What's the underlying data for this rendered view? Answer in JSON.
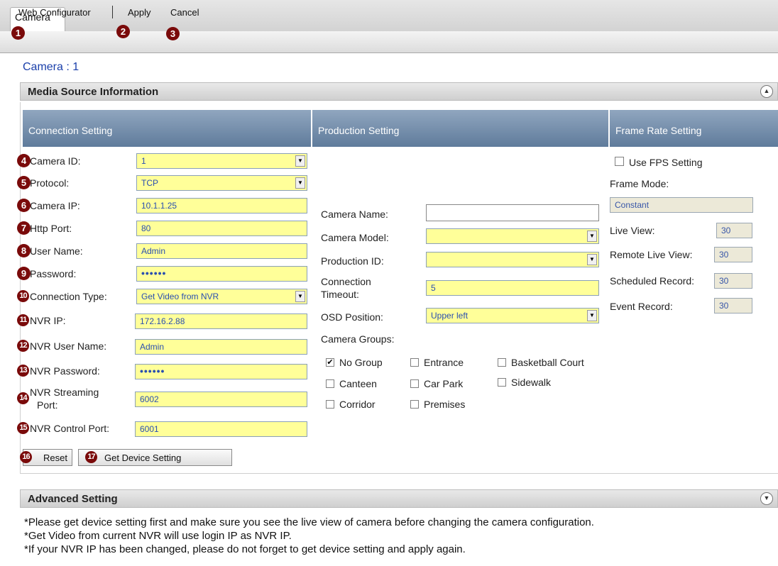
{
  "tab": {
    "label": "Camera"
  },
  "toolbar": {
    "web_configurator": "Web Configurator",
    "apply": "Apply",
    "cancel": "Cancel"
  },
  "page_title": "Camera : 1",
  "media_section": {
    "title": "Media Source Information"
  },
  "columns": {
    "connection": "Connection Setting",
    "production": "Production Setting",
    "framerate": "Frame Rate Setting"
  },
  "connection": {
    "camera_id": {
      "label": "Camera ID:",
      "value": "1"
    },
    "protocol": {
      "label": "Protocol:",
      "value": "TCP"
    },
    "camera_ip": {
      "label": "Camera IP:",
      "value": "10.1.1.25"
    },
    "http_port": {
      "label": "Http Port:",
      "value": "80"
    },
    "user_name": {
      "label": "User Name:",
      "value": "Admin"
    },
    "password": {
      "label": "Password:",
      "value": "••••••"
    },
    "connection_type": {
      "label": "Connection Type:",
      "value": "Get Video from NVR"
    },
    "nvr_ip": {
      "label": "NVR IP:",
      "value": "172.16.2.88"
    },
    "nvr_user_name": {
      "label": "NVR User Name:",
      "value": "Admin"
    },
    "nvr_password": {
      "label": "NVR Password:",
      "value": "••••••"
    },
    "nvr_streaming_port": {
      "label_line1": "NVR Streaming",
      "label_line2": "Port:",
      "value": "6002"
    },
    "nvr_control_port": {
      "label": "NVR Control Port:",
      "value": "6001"
    },
    "reset_button": "Reset",
    "get_device_button": "Get Device Setting"
  },
  "production": {
    "camera_name": {
      "label": "Camera Name:",
      "value": ""
    },
    "camera_model": {
      "label": "Camera Model:",
      "value": ""
    },
    "production_id": {
      "label": "Production ID:",
      "value": ""
    },
    "connection_timeout": {
      "label_line1": "Connection",
      "label_line2": "Timeout:",
      "value": "5"
    },
    "osd_position": {
      "label": "OSD Position:",
      "value": "Upper left"
    },
    "camera_groups": {
      "label": "Camera Groups:",
      "items": [
        {
          "label": "No Group",
          "checked": true
        },
        {
          "label": "Entrance",
          "checked": false
        },
        {
          "label": "Basketball Court",
          "checked": false
        },
        {
          "label": "Canteen",
          "checked": false
        },
        {
          "label": "Car Park",
          "checked": false
        },
        {
          "label": "Sidewalk",
          "checked": false
        },
        {
          "label": "Corridor",
          "checked": false
        },
        {
          "label": "Premises",
          "checked": false
        }
      ]
    }
  },
  "framerate": {
    "use_fps": {
      "label": "Use FPS Setting",
      "checked": false
    },
    "frame_mode": {
      "label": "Frame Mode:",
      "value": "Constant"
    },
    "live_view": {
      "label": "Live View:",
      "value": "30"
    },
    "remote_live_view": {
      "label": "Remote Live View:",
      "value": "30"
    },
    "scheduled_record": {
      "label": "Scheduled Record:",
      "value": "30"
    },
    "event_record": {
      "label": "Event Record:",
      "value": "30"
    }
  },
  "advanced_section": {
    "title": "Advanced Setting"
  },
  "notes": [
    "*Please get device setting first and make sure you see the live view of camera before changing the camera configuration.",
    "*Get Video from current NVR will use login IP as NVR IP.",
    "*If your NVR IP has been changed, please do not forget to get device setting and apply again."
  ],
  "badges": [
    "1",
    "2",
    "3",
    "4",
    "5",
    "6",
    "7",
    "8",
    "9",
    "10",
    "11",
    "12",
    "13",
    "14",
    "15",
    "16",
    "17"
  ],
  "colors": {
    "field_yellow": "#ffff99",
    "title_blue": "#1a3faa",
    "header_blue": "#6f88a6",
    "badge": "#7a0a0a"
  }
}
